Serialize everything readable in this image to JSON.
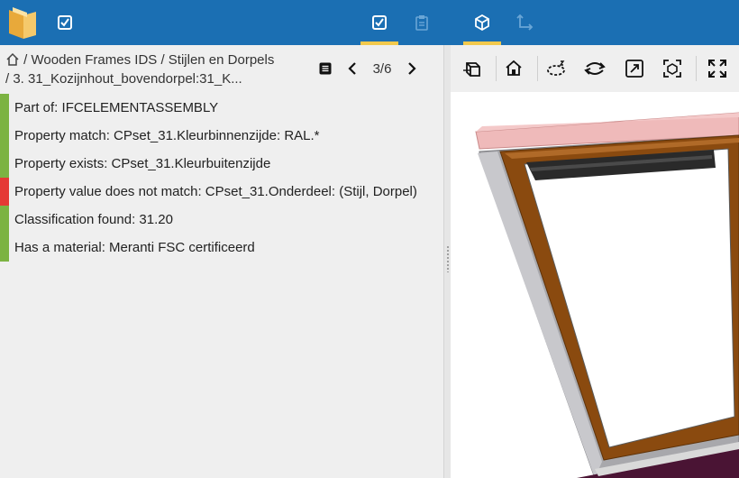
{
  "topbar": {
    "logo": "logo-book-icon",
    "left_icon": "check-square-icon",
    "tabs": [
      {
        "icon": "check-square-icon",
        "active": true
      },
      {
        "icon": "clipboard-icon",
        "active": false,
        "disabled": true
      },
      {
        "icon": "cube-icon",
        "active": true
      },
      {
        "icon": "axes-icon",
        "active": false,
        "disabled": true
      }
    ],
    "colors": {
      "bar": "#1b6fb3",
      "underline": "#f2c94c"
    }
  },
  "breadcrumb": {
    "home_icon": "home-icon",
    "line1": "/ Wooden Frames IDS / Stijlen en Dorpels",
    "line2": "/ 3. 31_Kozijnhout_bovendorpel:31_K..."
  },
  "navigation": {
    "page": "3/6",
    "list_icon": "list-icon",
    "prev_icon": "chevron-left-icon",
    "next_icon": "chevron-right-icon"
  },
  "results": [
    {
      "text": "Part of: IFCELEMENTASSEMBLY",
      "status": "pass"
    },
    {
      "text": "Property match: CPset_31.Kleurbinnenzijde: RAL.*",
      "status": "pass"
    },
    {
      "text": "Property exists: CPset_31.Kleurbuitenzijde",
      "status": "pass"
    },
    {
      "text": "Property value does not match: CPset_31.Onderdeel: (Stijl, Dorpel)",
      "status": "fail"
    },
    {
      "text": "Classification found: 31.20",
      "status": "pass"
    },
    {
      "text": "Has a material: Meranti FSC certificeerd",
      "status": "pass"
    }
  ],
  "status_colors": {
    "pass": "#7cb342",
    "fail": "#e53935"
  },
  "viewer_toolbar": [
    "perspective-cube-icon",
    "home-view-icon",
    "orbit-icon",
    "rotate-icon",
    "fit-view-icon",
    "focus-selection-icon",
    "fullscreen-icon"
  ]
}
